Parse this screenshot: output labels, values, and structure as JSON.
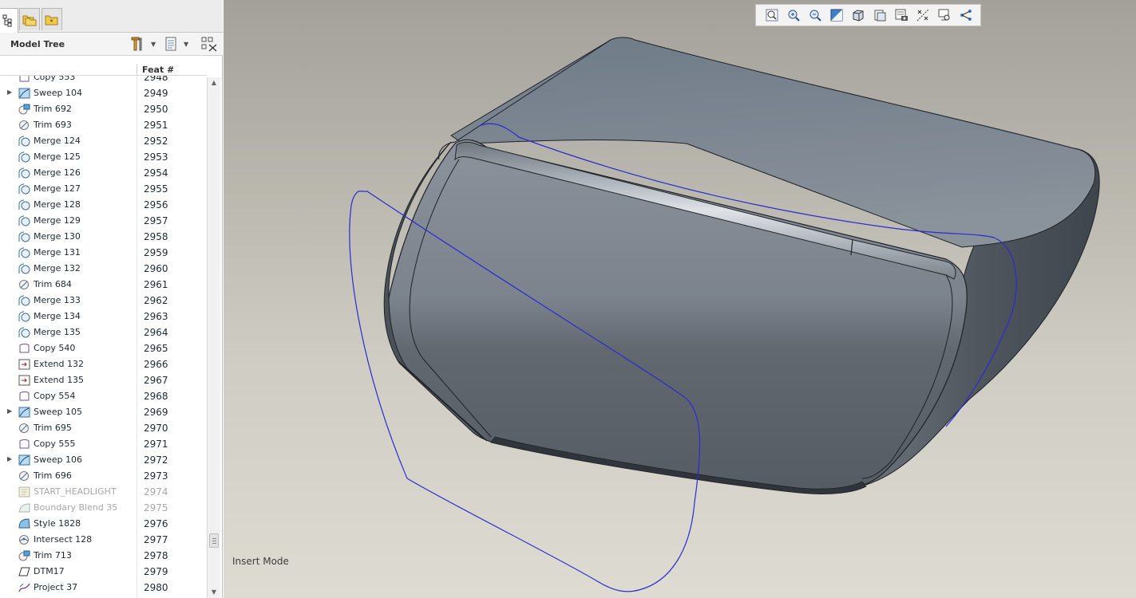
{
  "tabs": [
    {
      "icon": "model-tree-icon"
    },
    {
      "icon": "folder-browser-icon"
    },
    {
      "icon": "favorites-icon"
    }
  ],
  "tree": {
    "title": "Model Tree",
    "column_feat": "Feat #",
    "rows": [
      {
        "name": "Copy 553",
        "num": "2948",
        "icon": "copy",
        "expand": false,
        "suppressed": false
      },
      {
        "name": "Sweep 104",
        "num": "2949",
        "icon": "sweep",
        "expand": true,
        "suppressed": false
      },
      {
        "name": "Trim 692",
        "num": "2950",
        "icon": "trim-q",
        "expand": false,
        "suppressed": false
      },
      {
        "name": "Trim 693",
        "num": "2951",
        "icon": "trim",
        "expand": false,
        "suppressed": false
      },
      {
        "name": "Merge 124",
        "num": "2952",
        "icon": "merge",
        "expand": false,
        "suppressed": false
      },
      {
        "name": "Merge 125",
        "num": "2953",
        "icon": "merge",
        "expand": false,
        "suppressed": false
      },
      {
        "name": "Merge 126",
        "num": "2954",
        "icon": "merge",
        "expand": false,
        "suppressed": false
      },
      {
        "name": "Merge 127",
        "num": "2955",
        "icon": "merge",
        "expand": false,
        "suppressed": false
      },
      {
        "name": "Merge 128",
        "num": "2956",
        "icon": "merge",
        "expand": false,
        "suppressed": false
      },
      {
        "name": "Merge 129",
        "num": "2957",
        "icon": "merge",
        "expand": false,
        "suppressed": false
      },
      {
        "name": "Merge 130",
        "num": "2958",
        "icon": "merge",
        "expand": false,
        "suppressed": false
      },
      {
        "name": "Merge 131",
        "num": "2959",
        "icon": "merge",
        "expand": false,
        "suppressed": false
      },
      {
        "name": "Merge 132",
        "num": "2960",
        "icon": "merge",
        "expand": false,
        "suppressed": false
      },
      {
        "name": "Trim 684",
        "num": "2961",
        "icon": "trim",
        "expand": false,
        "suppressed": false
      },
      {
        "name": "Merge 133",
        "num": "2962",
        "icon": "merge",
        "expand": false,
        "suppressed": false
      },
      {
        "name": "Merge 134",
        "num": "2963",
        "icon": "merge",
        "expand": false,
        "suppressed": false
      },
      {
        "name": "Merge 135",
        "num": "2964",
        "icon": "merge",
        "expand": false,
        "suppressed": false
      },
      {
        "name": "Copy 540",
        "num": "2965",
        "icon": "copy",
        "expand": false,
        "suppressed": false
      },
      {
        "name": "Extend 132",
        "num": "2966",
        "icon": "extend",
        "expand": false,
        "suppressed": false
      },
      {
        "name": "Extend 135",
        "num": "2967",
        "icon": "extend",
        "expand": false,
        "suppressed": false
      },
      {
        "name": "Copy 554",
        "num": "2968",
        "icon": "copy",
        "expand": false,
        "suppressed": false
      },
      {
        "name": "Sweep 105",
        "num": "2969",
        "icon": "sweep",
        "expand": true,
        "suppressed": false
      },
      {
        "name": "Trim 695",
        "num": "2970",
        "icon": "trim",
        "expand": false,
        "suppressed": false
      },
      {
        "name": "Copy 555",
        "num": "2971",
        "icon": "copy",
        "expand": false,
        "suppressed": false
      },
      {
        "name": "Sweep 106",
        "num": "2972",
        "icon": "sweep",
        "expand": true,
        "suppressed": false
      },
      {
        "name": "Trim 696",
        "num": "2973",
        "icon": "trim",
        "expand": false,
        "suppressed": false
      },
      {
        "name": "START_HEADLIGHT",
        "num": "2974",
        "icon": "group",
        "expand": false,
        "suppressed": true
      },
      {
        "name": "Boundary Blend 35",
        "num": "2975",
        "icon": "boundary",
        "expand": false,
        "suppressed": true
      },
      {
        "name": "Style 1828",
        "num": "2976",
        "icon": "style",
        "expand": false,
        "suppressed": false
      },
      {
        "name": "Intersect 128",
        "num": "2977",
        "icon": "intersect",
        "expand": false,
        "suppressed": false
      },
      {
        "name": "Trim 713",
        "num": "2978",
        "icon": "trim-q",
        "expand": false,
        "suppressed": false
      },
      {
        "name": "DTM17",
        "num": "2979",
        "icon": "datum",
        "expand": false,
        "suppressed": false
      },
      {
        "name": "Project 37",
        "num": "2980",
        "icon": "project",
        "expand": false,
        "suppressed": false
      }
    ]
  },
  "viewport": {
    "status_text": "Insert Mode",
    "toolbar": [
      "refit-icon",
      "zoom-in-icon",
      "zoom-out-icon",
      "repaint-icon",
      "display-style-icon",
      "saved-views-icon",
      "view-manager-icon",
      "datum-display-icon",
      "spin-center-icon",
      "annotation-display-icon"
    ]
  },
  "colors": {
    "sketch_curve": "#2b2bd0",
    "model_surface": "#7c8490",
    "suppressed_text": "#a7a7a7"
  }
}
